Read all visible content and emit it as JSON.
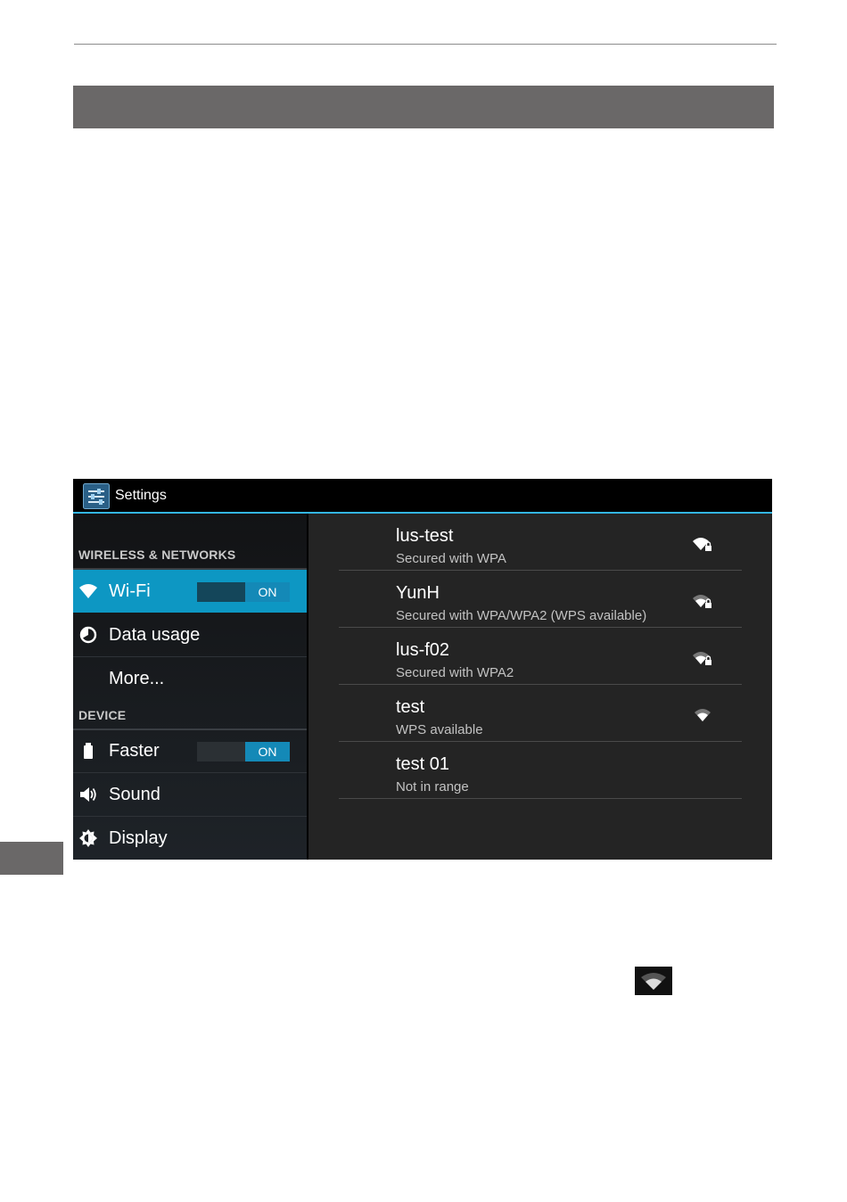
{
  "settings": {
    "title": "Settings",
    "accent": "#33b5e5",
    "categories": {
      "wireless": "WIRELESS & NETWORKS",
      "device": "DEVICE"
    },
    "items": [
      {
        "label": "Wi-Fi",
        "icon": "wifi-icon",
        "toggle": "ON",
        "selected": true
      },
      {
        "label": "Data usage",
        "icon": "data-usage-icon"
      },
      {
        "label": "More..."
      },
      {
        "label": "Faster",
        "icon": "battery-icon",
        "toggle": "ON"
      },
      {
        "label": "Sound",
        "icon": "speaker-icon"
      },
      {
        "label": "Display",
        "icon": "brightness-icon"
      }
    ],
    "networks": [
      {
        "name": "lus-test",
        "status": "Secured with WPA",
        "icon": "wifi-locked-icon"
      },
      {
        "name": "YunH",
        "status": "Secured with WPA/WPA2 (WPS available)",
        "icon": "wifi-locked-icon"
      },
      {
        "name": "lus-f02",
        "status": "Secured with WPA2",
        "icon": "wifi-locked-icon"
      },
      {
        "name": "test",
        "status": "WPS available",
        "icon": "wifi-icon"
      },
      {
        "name": "test 01",
        "status": "Not in range"
      }
    ]
  }
}
